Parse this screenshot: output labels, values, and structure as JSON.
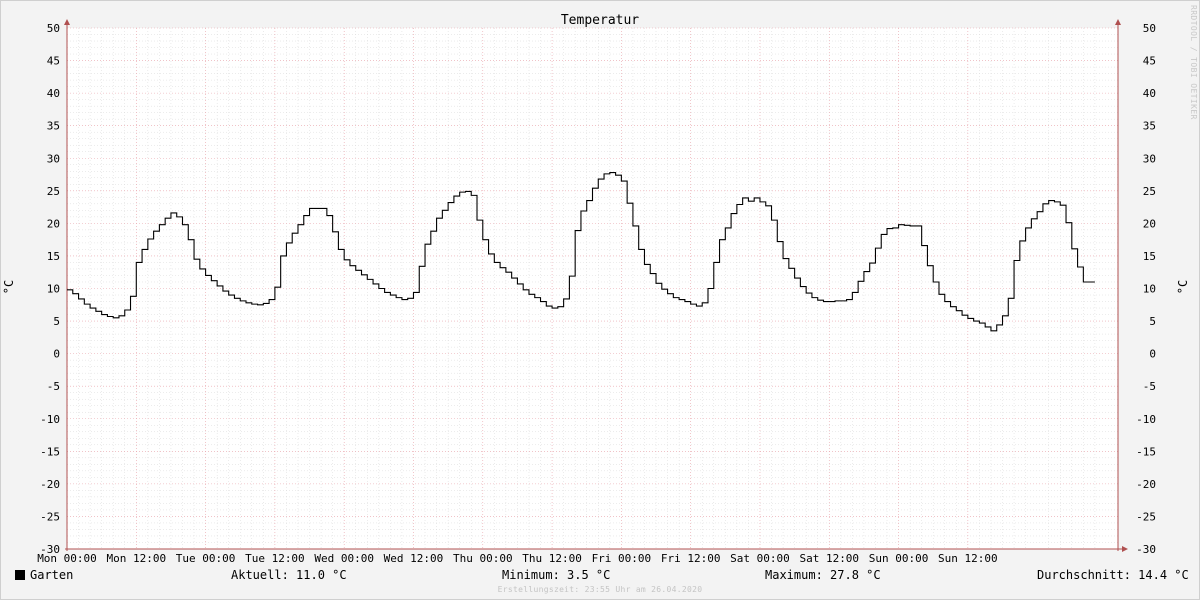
{
  "chart_data": {
    "type": "line",
    "title": "Temperatur",
    "ylabel": "°C",
    "ylim": [
      -30,
      50
    ],
    "y_ticks": [
      "50",
      "45",
      "40",
      "35",
      "30",
      "25",
      "20",
      "15",
      "10",
      "5",
      "0",
      "-5",
      "-10",
      "-15",
      "-20",
      "-25",
      "-30"
    ],
    "x_ticks": [
      "Mon 00:00",
      "Mon 12:00",
      "Tue 00:00",
      "Tue 12:00",
      "Wed 00:00",
      "Wed 12:00",
      "Thu 00:00",
      "Thu 12:00",
      "Fri 00:00",
      "Fri 12:00",
      "Sat 00:00",
      "Sat 12:00",
      "Sun 00:00",
      "Sun 12:00"
    ],
    "x_range_hours": [
      0,
      182
    ],
    "grid": true,
    "series": [
      {
        "name": "Garten",
        "step": true,
        "color": "#000000",
        "x_hours": [
          0,
          1,
          2,
          3,
          4,
          5,
          6,
          7,
          8,
          9,
          10,
          11,
          12,
          13,
          14,
          15,
          16,
          17,
          18,
          19,
          20,
          21,
          22,
          23,
          24,
          25,
          26,
          27,
          28,
          29,
          30,
          31,
          32,
          33,
          34,
          35,
          36,
          37,
          38,
          39,
          40,
          41,
          42,
          43,
          44,
          45,
          46,
          47,
          48,
          49,
          50,
          51,
          52,
          53,
          54,
          55,
          56,
          57,
          58,
          59,
          60,
          61,
          62,
          63,
          64,
          65,
          66,
          67,
          68,
          69,
          70,
          71,
          72,
          73,
          74,
          75,
          76,
          77,
          78,
          79,
          80,
          81,
          82,
          83,
          84,
          85,
          86,
          87,
          88,
          89,
          90,
          91,
          92,
          93,
          94,
          95,
          96,
          97,
          98,
          99,
          100,
          101,
          102,
          103,
          104,
          105,
          106,
          107,
          108,
          109,
          110,
          111,
          112,
          113,
          114,
          115,
          116,
          117,
          118,
          119,
          120,
          121,
          122,
          123,
          124,
          125,
          126,
          127,
          128,
          129,
          130,
          131,
          132,
          133,
          134,
          135,
          136,
          137,
          138,
          139,
          140,
          141,
          142,
          143,
          144,
          145,
          146,
          147,
          148,
          149,
          150,
          151,
          152,
          153,
          154,
          155,
          156,
          157,
          158,
          159,
          160,
          161,
          162,
          163,
          164,
          165,
          166,
          167,
          168,
          169,
          170,
          171,
          172,
          173,
          174,
          175,
          176,
          177,
          178,
          179,
          180
        ],
        "values": [
          9.8,
          9.2,
          8.4,
          7.6,
          7.0,
          6.5,
          6.0,
          5.7,
          5.5,
          5.8,
          6.7,
          8.8,
          14.0,
          16.0,
          17.6,
          18.8,
          19.8,
          20.8,
          21.6,
          21.0,
          19.8,
          17.5,
          14.5,
          13.0,
          12.0,
          11.2,
          10.4,
          9.6,
          9.0,
          8.5,
          8.1,
          7.8,
          7.6,
          7.5,
          7.7,
          8.3,
          10.2,
          15.0,
          17.0,
          18.5,
          19.8,
          21.2,
          22.3,
          22.3,
          22.3,
          21.2,
          18.7,
          16.0,
          14.4,
          13.5,
          12.8,
          12.1,
          11.4,
          10.7,
          10.0,
          9.4,
          9.0,
          8.6,
          8.3,
          8.5,
          9.4,
          13.4,
          16.8,
          18.8,
          20.8,
          22.0,
          23.2,
          24.2,
          24.8,
          24.9,
          24.3,
          20.5,
          17.5,
          15.3,
          14.0,
          13.2,
          12.5,
          11.6,
          10.7,
          9.8,
          9.1,
          8.6,
          8.0,
          7.3,
          7.0,
          7.2,
          8.4,
          11.9,
          18.9,
          21.9,
          23.5,
          25.4,
          26.8,
          27.6,
          27.8,
          27.4,
          26.5,
          23.1,
          19.6,
          16.0,
          13.7,
          12.3,
          10.8,
          9.9,
          9.2,
          8.6,
          8.3,
          8.0,
          7.6,
          7.3,
          7.8,
          10.0,
          14.0,
          17.5,
          19.3,
          21.5,
          22.9,
          23.9,
          23.4,
          23.9,
          23.3,
          22.7,
          20.5,
          17.2,
          14.6,
          13.1,
          11.6,
          10.3,
          9.3,
          8.6,
          8.2,
          8.0,
          8.0,
          8.1,
          8.1,
          8.3,
          9.4,
          11.1,
          12.6,
          13.9,
          16.2,
          18.3,
          19.2,
          19.3,
          19.8,
          19.7,
          19.6,
          19.6,
          16.6,
          13.5,
          11.0,
          9.1,
          8.0,
          7.2,
          6.6,
          5.9,
          5.4,
          5.0,
          4.7,
          4.1,
          3.5,
          4.4,
          5.8,
          8.5,
          14.3,
          17.3,
          19.3,
          20.7,
          21.8,
          23.0,
          23.5,
          23.3,
          22.8,
          20.1,
          16.1,
          13.3,
          11.0,
          11.0
        ]
      }
    ]
  },
  "legend": {
    "series_name": "Garten",
    "aktuell": "Aktuell: 11.0 °C",
    "minimum": "Minimum: 3.5 °C",
    "maximum": "Maximum: 27.8 °C",
    "durchschnitt": "Durchschnitt: 14.4 °C"
  },
  "footer": "Erstellungszeit: 23:55 Uhr am 26.04.2020",
  "watermark": "RRDTOOL / TOBI OETIKER",
  "colors": {
    "major_grid": "#e8a0a8",
    "minor_grid": "#d8d8d8",
    "axis": "#b05050",
    "background": "#f3f3f3",
    "plot_background": "#ffffff",
    "line": "#000000"
  }
}
